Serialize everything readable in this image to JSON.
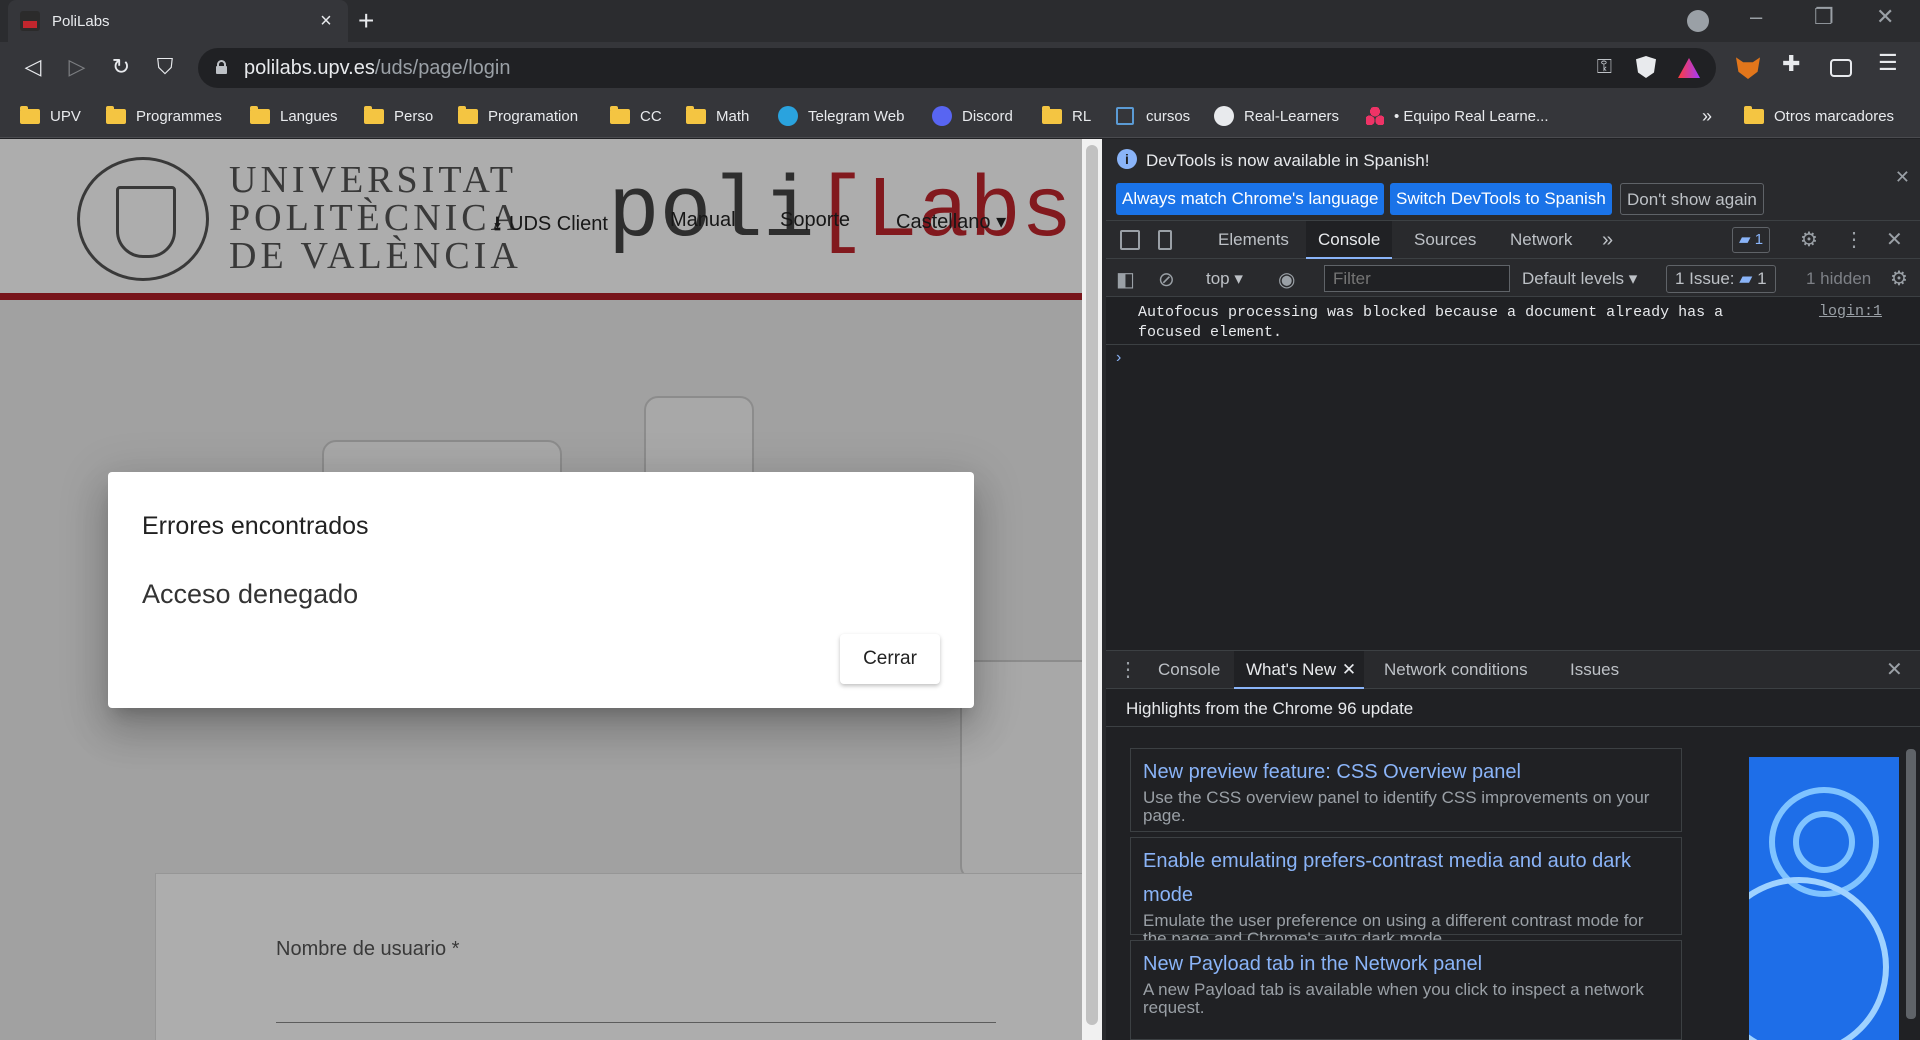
{
  "browser": {
    "tab_title": "PoliLabs",
    "url_host": "polilabs.upv.es",
    "url_path": "/uds/page/login"
  },
  "bookmarks": [
    {
      "label": "UPV",
      "icon": "folder-icon"
    },
    {
      "label": "Programmes",
      "icon": "folder-icon"
    },
    {
      "label": "Langues",
      "icon": "folder-icon"
    },
    {
      "label": "Perso",
      "icon": "folder-icon"
    },
    {
      "label": "Programation",
      "icon": "folder-icon"
    },
    {
      "label": "CC",
      "icon": "folder-icon"
    },
    {
      "label": "Math",
      "icon": "folder-icon"
    },
    {
      "label": "Telegram Web",
      "icon": "telegram-icon"
    },
    {
      "label": "Discord",
      "icon": "discord-icon"
    },
    {
      "label": "RL",
      "icon": "folder-icon"
    },
    {
      "label": "cursos",
      "icon": "bookmark-icon"
    },
    {
      "label": "Real-Learners",
      "icon": "github-icon"
    },
    {
      "label": "• Equipo Real Learne...",
      "icon": "team-icon"
    }
  ],
  "bookmarks_more": "»",
  "other_bookmarks": "Otros marcadores",
  "page": {
    "uni_line1": "UNIVERSITAT",
    "uni_line2": "POLITÈCNICA",
    "uni_line3": "DE VALÈNCIA",
    "logo_text_a": "poli",
    "logo_text_b": "[Labs]",
    "nav": {
      "uds_client": "UDS Client",
      "manual": "Manual",
      "soporte": "Soporte",
      "language": "Castellano"
    },
    "login_username_label": "Nombre de usuario *"
  },
  "dialog": {
    "title": "Errores encontrados",
    "message": "Acceso denegado",
    "close_label": "Cerrar"
  },
  "devtools": {
    "infobar_text": "DevTools is now available in Spanish!",
    "btn_match": "Always match Chrome's language",
    "btn_switch": "Switch DevTools to Spanish",
    "btn_dismiss": "Don't show again",
    "tabs": [
      "Elements",
      "Console",
      "Sources",
      "Network"
    ],
    "active_tab": "Console",
    "more_tabs": "»",
    "messages_badge": "1",
    "context": "top",
    "filter_placeholder": "Filter",
    "levels": "Default levels",
    "issues_label": "1 Issue:",
    "issues_count": "1",
    "hidden": "1 hidden",
    "console_message": "Autofocus processing was blocked because a document already has a focused element.",
    "console_source": "login:1",
    "prompt": "›",
    "drawer_tabs": [
      "Console",
      "What's New",
      "Network conditions",
      "Issues"
    ],
    "drawer_active": "What's New",
    "whats_new_header": "Highlights from the Chrome 96 update",
    "cards": [
      {
        "title": "New preview feature: CSS Overview panel",
        "desc": "Use the CSS overview panel to identify CSS improvements on your page."
      },
      {
        "title": "Enable emulating prefers-contrast media and auto dark mode",
        "desc": "Emulate the user preference on using a different contrast mode for the page and Chrome's auto dark mode."
      },
      {
        "title": "New Payload tab in the Network panel",
        "desc": "A new Payload tab is available when you click to inspect a network request."
      }
    ]
  },
  "colors": {
    "accent_red": "#b11f28",
    "devtools_blue": "#1a73e8",
    "link_blue": "#8ab4f8"
  }
}
